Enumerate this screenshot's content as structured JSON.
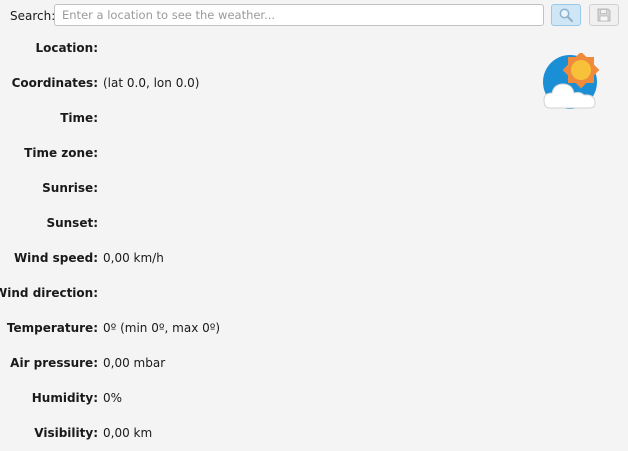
{
  "search": {
    "label": "Search:",
    "placeholder": "Enter a location to see the weather...",
    "value": ""
  },
  "icons": {
    "search_button": "magnifier-icon",
    "save_button": "floppy-disk-icon",
    "weather": "partly-cloudy-icon"
  },
  "colors": {
    "background": "#f4f4f4",
    "search_button_bg": "#cfe6f6",
    "weather_sky": "#1a8fd6",
    "weather_sun": "#f7c23a",
    "weather_sun_rays": "#f08b3c"
  },
  "fields": [
    {
      "key": "location",
      "label": "Location:",
      "value": ""
    },
    {
      "key": "coordinates",
      "label": "Coordinates:",
      "value": "(lat 0.0, lon 0.0)"
    },
    {
      "key": "time",
      "label": "Time:",
      "value": ""
    },
    {
      "key": "time-zone",
      "label": "Time zone:",
      "value": ""
    },
    {
      "key": "sunrise",
      "label": "Sunrise:",
      "value": ""
    },
    {
      "key": "sunset",
      "label": "Sunset:",
      "value": ""
    },
    {
      "key": "wind-speed",
      "label": "Wind speed:",
      "value": "0,00 km/h"
    },
    {
      "key": "wind-direction",
      "label": "Wind direction:",
      "value": ""
    },
    {
      "key": "temperature",
      "label": "Temperature:",
      "value": "0º (min 0º, max 0º)"
    },
    {
      "key": "air-pressure",
      "label": "Air pressure:",
      "value": "0,00 mbar"
    },
    {
      "key": "humidity",
      "label": "Humidity:",
      "value": "0%"
    },
    {
      "key": "visibility",
      "label": "Visibility:",
      "value": "0,00 km"
    }
  ]
}
